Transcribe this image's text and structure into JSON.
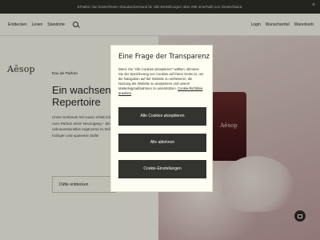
{
  "promo": {
    "text": "Erhalten Sie kostenfreien Standardversand für alle Bestellungen über 29€ innerhalb von Deutschland.",
    "close": "×"
  },
  "nav": {
    "left": [
      "Entdecken",
      "Lesen",
      "Standorte"
    ],
    "right": [
      "Login",
      "Wunschzettel",
      "Warenkorb"
    ]
  },
  "brand": {
    "logo": "Aēsop"
  },
  "hero": {
    "eyebrow": "Eau de Parfum",
    "title": "Ein wachsendes Repertoire",
    "body": "Unser Sortiment mit nuanc erhält mit dem neuen Auro Parfum einen Neuzugang – dieses unkonventionelles ergänzend zu Duftkollektionen holzigen und opulenten Düfte",
    "cta": "Düfte entdecken",
    "bottle_label": "Aēsop"
  },
  "modal": {
    "title": "Eine Frage der Transparenz",
    "body": "Wenn Sie \"Alle Cookies akzeptieren\" wählen, stimmen Sie der Speicherung von Cookies auf Ihrem Gerät zu, um die Navigation auf der Website zu verbessern, die Nutzung der Website zu analysieren und unsere Marketingmaßnahmen zu unterstützen.",
    "link": "Cookie-Richtlinie ansehen",
    "buttons": {
      "accept": "Alle Cookies akzeptieren",
      "reject": "Alle ablehnen",
      "settings": "Cookie-Einstellungen"
    }
  }
}
